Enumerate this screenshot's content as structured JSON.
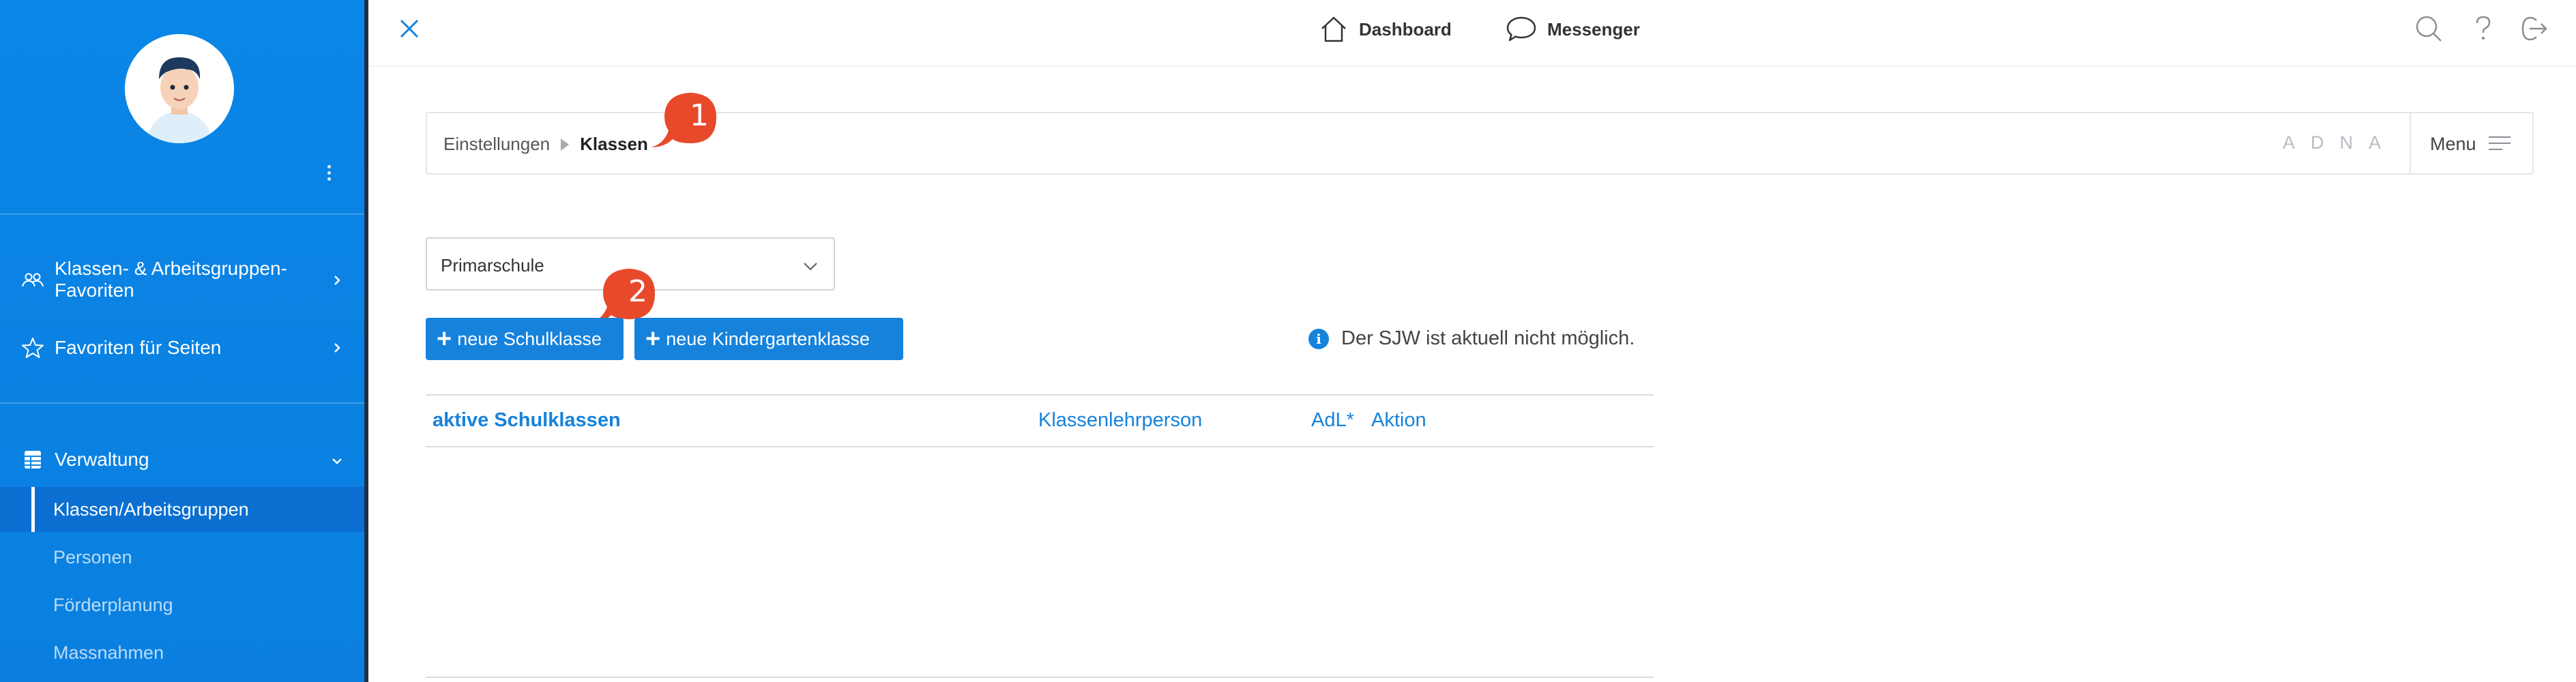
{
  "sidebar": {
    "groups": [
      {
        "label_line1": "Klassen- & Arbeitsgruppen-",
        "label_line2": "Favoriten",
        "icon": "group-icon"
      },
      {
        "label": "Favoriten für Seiten",
        "icon": "star-icon"
      }
    ],
    "section": {
      "label": "Verwaltung",
      "icon": "table-icon"
    },
    "items": [
      {
        "label": "Klassen/Arbeitsgruppen",
        "active": true
      },
      {
        "label": "Personen"
      },
      {
        "label": "Förderplanung"
      },
      {
        "label": "Massnahmen"
      }
    ]
  },
  "topbar": {
    "dashboard_label": "Dashboard",
    "messenger_label": "Messenger",
    "icons": [
      "close-icon",
      "home-icon",
      "chat-icon",
      "search-icon",
      "help-icon",
      "logout-icon"
    ]
  },
  "breadcrumb": {
    "parent": "Einstellungen",
    "current": "Klassen",
    "letters": "ADNA",
    "menu_label": "Menu"
  },
  "callouts": {
    "first": "1",
    "second": "2"
  },
  "filter": {
    "selected": "Primarschule"
  },
  "actions": {
    "new_school_class": "neue Schulklasse",
    "new_kindergarten_class": "neue Kindergartenklasse"
  },
  "info_text": "Der SJW ist aktuell nicht möglich.",
  "table": {
    "headers": [
      "aktive Schulklassen",
      "Klassenlehrperson",
      "AdL*",
      "Aktion"
    ]
  },
  "colors": {
    "primary": "#1682dc",
    "sidebar": "#0a86e6",
    "callout": "#e8492b"
  }
}
